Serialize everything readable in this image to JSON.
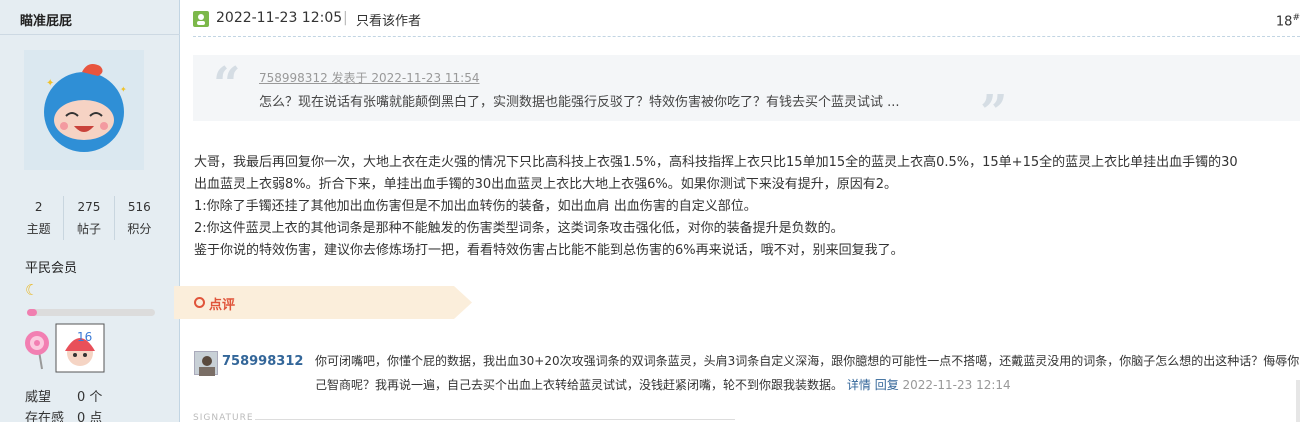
{
  "user": {
    "name": "瞄准屁屁",
    "stats": [
      {
        "value": "2",
        "label": "主题"
      },
      {
        "value": "275",
        "label": "帖子"
      },
      {
        "value": "516",
        "label": "积分"
      }
    ],
    "rank": "平民会员",
    "rank_icon": "moon-icon",
    "progress": 0.08,
    "extra": [
      {
        "label": "威望",
        "value": "0 个"
      },
      {
        "label": "存在感",
        "value": "0 点"
      }
    ]
  },
  "post": {
    "time": "2022-11-23 12:05",
    "separator": "|",
    "only_author": "只看该作者",
    "floor": "18",
    "floor_sup": "#"
  },
  "quote": {
    "author_line": "758998312 发表于 2022-11-23 11:54",
    "text": "怎么？现在说话有张嘴就能颠倒黑白了，实测数据也能强行反驳了？特效伤害被你吃了？有钱去买个蓝灵试试 ..."
  },
  "content": [
    "大哥，我最后再回复你一次，大地上衣在走火强的情况下只比高科技上衣强1.5%，高科技指挥上衣只比15单加15全的蓝灵上衣高0.5%，15单+15全的蓝灵上衣比单挂出血手镯的30",
    "出血蓝灵上衣弱8%。折合下来，单挂出血手镯的30出血蓝灵上衣比大地上衣强6%。如果你测试下来没有提升，原因有2。",
    "1:你除了手镯还挂了其他加出血伤害但是不加出血转伤的装备，如出血肩 出血伤害的自定义部位。",
    "2:你这件蓝灵上衣的其他词条是那种不能触发的伤害类型词条，这类词条攻击强化低，对你的装备提升是负数的。",
    "鉴于你说的特效伤害，建议你去修炼场打一把，看看特效伤害占比能不能到总伤害的6%再来说话，哦不对，别来回复我了。"
  ],
  "comments_label": "点评",
  "comment": {
    "user": "758998312",
    "line1": "你可闭嘴吧，你懂个屁的数据，我出血30+20次攻强词条的双词条蓝灵，头肩3词条自定义深海，跟你臆想的可能性一点不搭噶，还戴蓝灵没用的词条，你脑子怎么想的出这种话？侮辱你自",
    "line2": "己智商呢？我再说一遍，自己去买个出血上衣转给蓝灵试试，没钱赶紧闭嘴，轮不到你跟我装数据。",
    "detail": "详情",
    "reply": "回复",
    "time": "2022-11-23 12:14"
  },
  "signature_label": "SIGNATURE",
  "colors": {
    "sidebar_bg": "#e5edf2",
    "link": "#336699",
    "comment_accent": "#e0543a",
    "comment_tab_bg": "#fbeedb"
  }
}
